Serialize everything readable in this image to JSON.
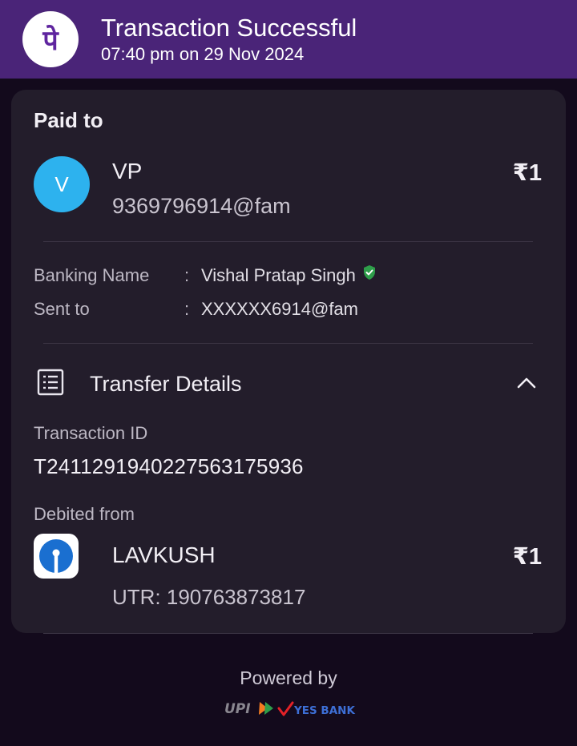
{
  "header": {
    "title": "Transaction Successful",
    "subtitle": "07:40 pm on 29 Nov 2024",
    "logo_glyph": "पे",
    "brand_color": "#4a2478"
  },
  "paid_to": {
    "heading": "Paid to",
    "avatar_letter": "V",
    "avatar_color": "#2db2ee",
    "name": "VP",
    "upi_id": "9369796914@fam",
    "amount": "₹1"
  },
  "details": {
    "banking_name_label": "Banking Name",
    "banking_name_value": "Vishal Pratap Singh",
    "sent_to_label": "Sent to",
    "sent_to_value": "XXXXXX6914@fam",
    "separator": ":",
    "verified_icon": "shield-check-icon"
  },
  "transfer": {
    "title": "Transfer Details",
    "transaction_id_label": "Transaction ID",
    "transaction_id": "T2411291940227563175936",
    "debited_from_label": "Debited from",
    "account_name": "LAVKUSH",
    "utr": "UTR: 190763873817",
    "amount": "₹1"
  },
  "footer": {
    "powered_by": "Powered by",
    "upi_text": "UPI",
    "bank_text": "YES BANK"
  }
}
